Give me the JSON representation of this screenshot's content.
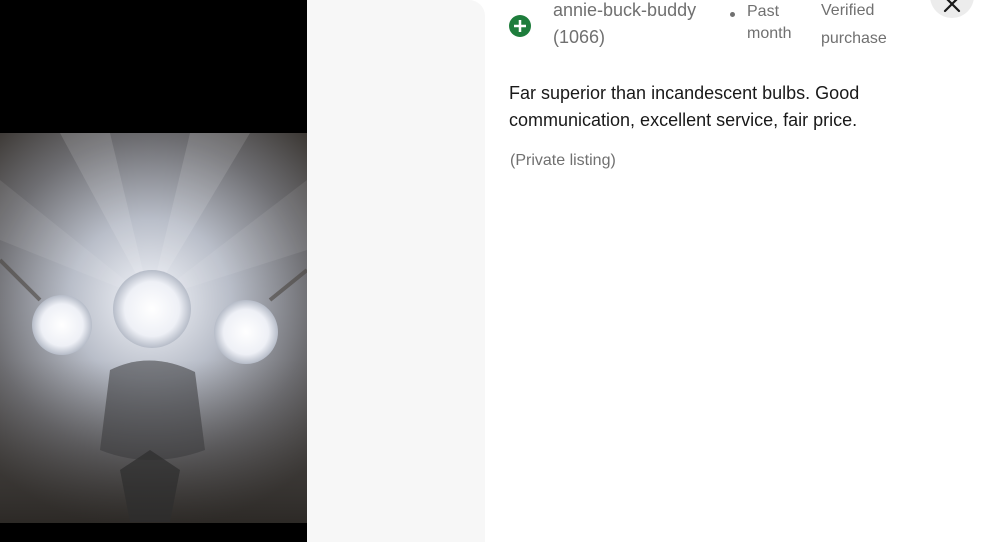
{
  "review_photo": {
    "description_icon": "review-photo"
  },
  "review": {
    "rating_icon": "plus-circle-icon",
    "reviewer_name": "annie-buck-buddy",
    "reviewer_score": "(1066)",
    "time_ago": "Past month",
    "verified_label": "Verified purchase",
    "text": "Far superior than incandescent bulbs. Good communication, excellent service, fair price.",
    "listing_note": "(Private listing)"
  },
  "controls": {
    "close_icon": "close-icon"
  },
  "colors": {
    "positive": "#1e7d3c",
    "muted_text": "#707070",
    "body_text": "#191919",
    "panel_bg": "#f7f7f7",
    "close_bg": "#ececec"
  }
}
